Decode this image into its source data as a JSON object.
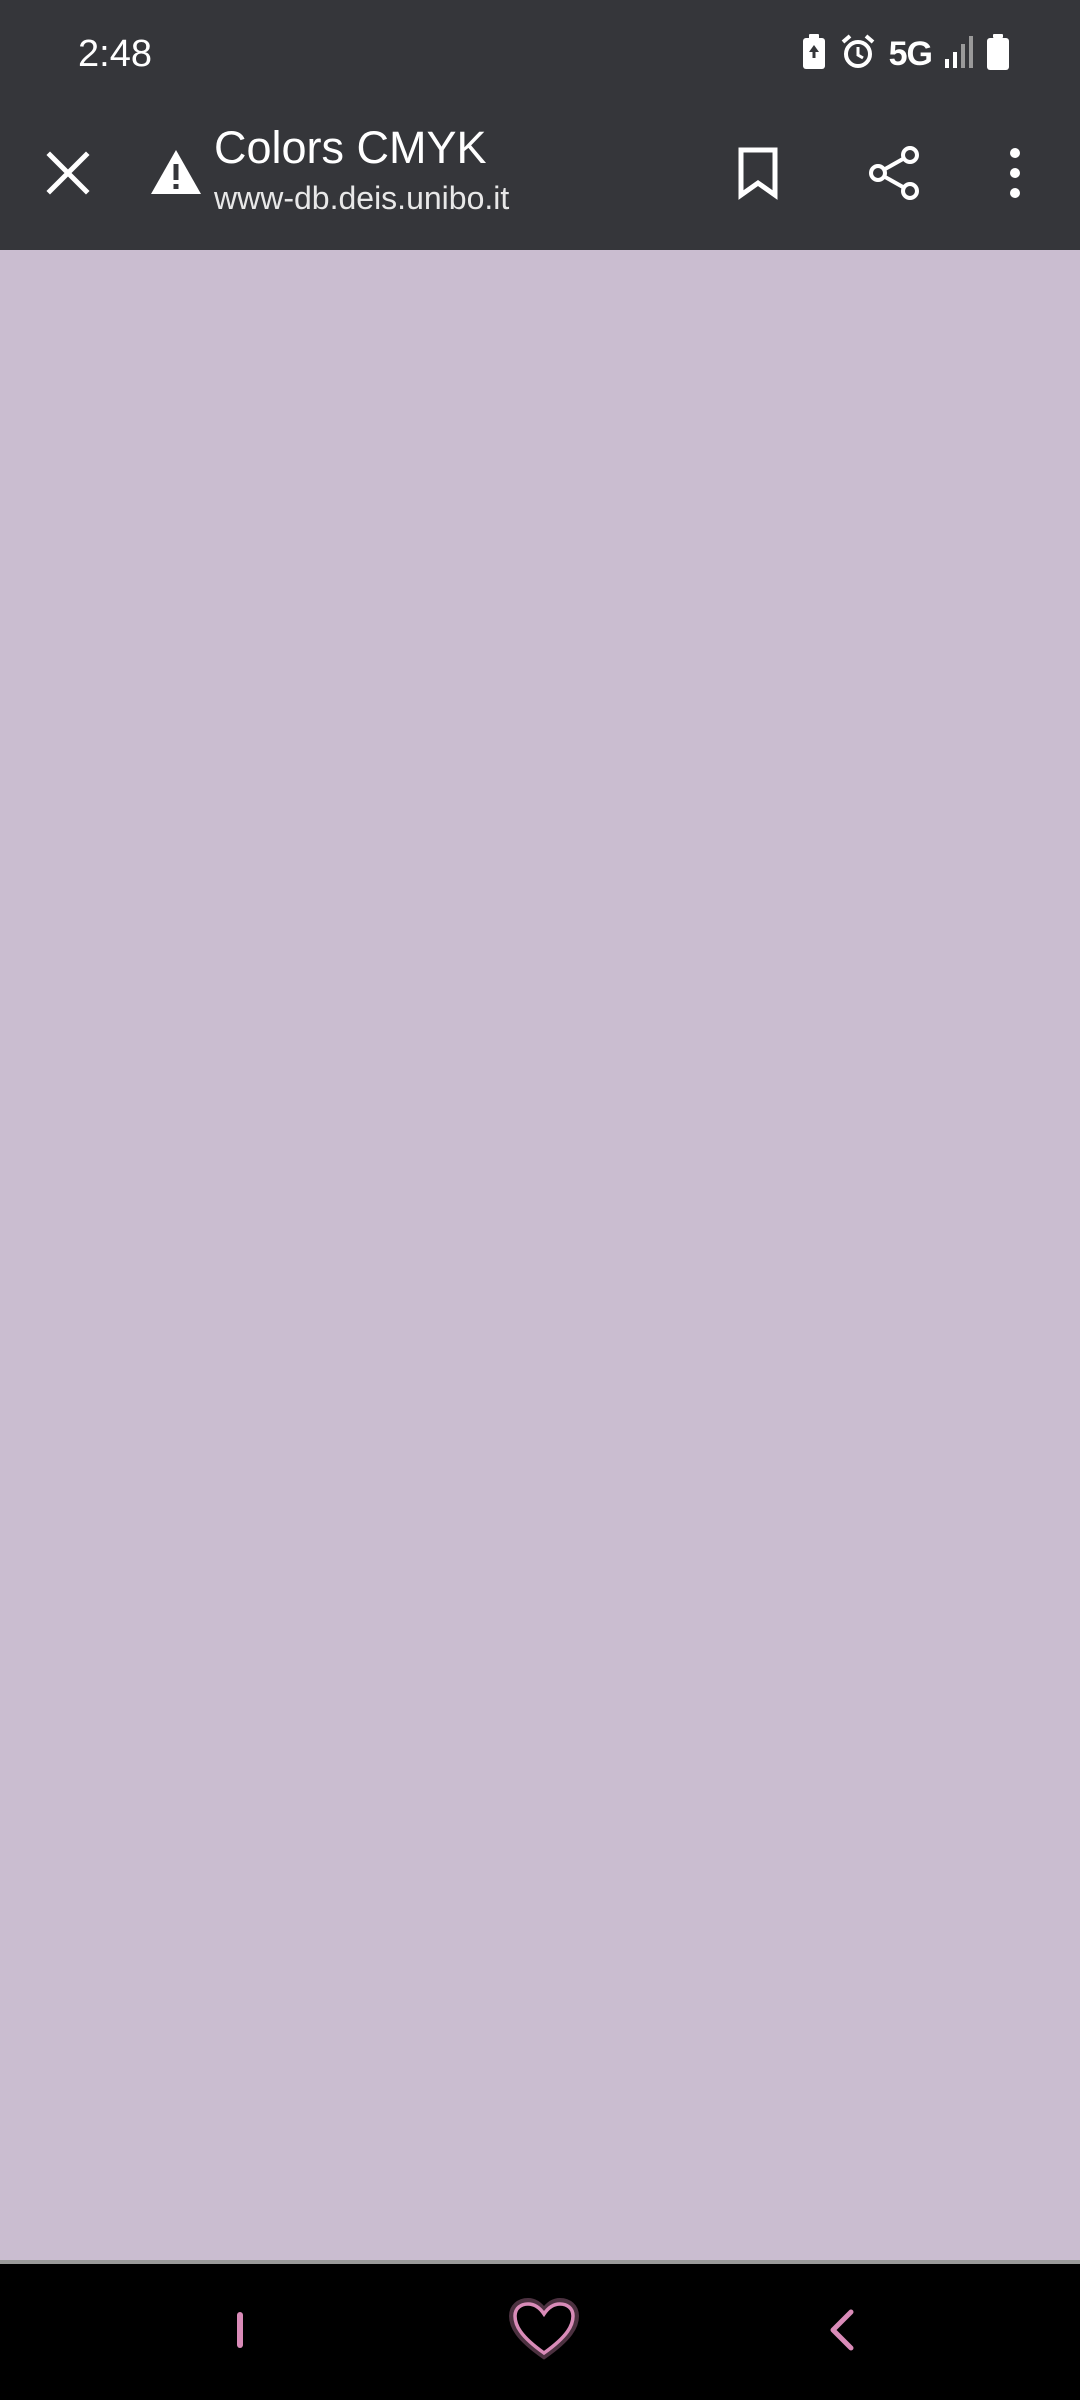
{
  "status_bar": {
    "time": "2:48",
    "network": "5G",
    "icons": [
      "battery-saver-icon",
      "alarm-icon",
      "signal-icon",
      "battery-icon"
    ]
  },
  "toolbar": {
    "title": "Colors CMYK",
    "url": "www-db.deis.unibo.it",
    "icons": [
      "close-icon",
      "warning-icon",
      "bookmark-icon",
      "share-icon",
      "more-vert-icon"
    ]
  },
  "content": {
    "background_color": "#cabdd0"
  },
  "nav_bar": {
    "icons": [
      "recents-icon",
      "home-heart-icon",
      "back-icon"
    ],
    "accent_color": "#d98bb8"
  }
}
